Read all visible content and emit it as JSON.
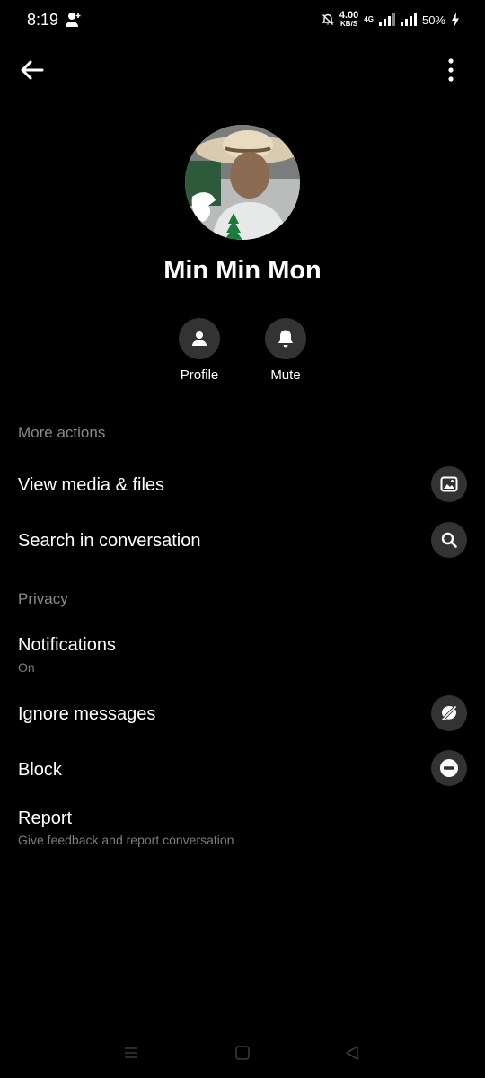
{
  "status_bar": {
    "time": "8:19",
    "speed_value": "4.00",
    "speed_unit": "KB/S",
    "network_type": "4G",
    "battery": "50%"
  },
  "contact": {
    "name": "Min Min Mon"
  },
  "quick_actions": {
    "profile_label": "Profile",
    "mute_label": "Mute"
  },
  "sections": {
    "more_actions": {
      "title": "More actions",
      "items": [
        {
          "label": "View media & files",
          "icon": "image-icon"
        },
        {
          "label": "Search in conversation",
          "icon": "search-icon"
        }
      ]
    },
    "privacy": {
      "title": "Privacy",
      "notifications": {
        "label": "Notifications",
        "value": "On"
      },
      "ignore": {
        "label": "Ignore messages",
        "icon": "ignore-icon"
      },
      "block": {
        "label": "Block",
        "icon": "block-icon"
      },
      "report": {
        "label": "Report",
        "subtitle": "Give feedback and report conversation"
      }
    }
  },
  "colors": {
    "background": "#000000",
    "icon_circle": "#333333",
    "section_title": "#8a8a8a",
    "subtitle": "#7d7d7d"
  }
}
